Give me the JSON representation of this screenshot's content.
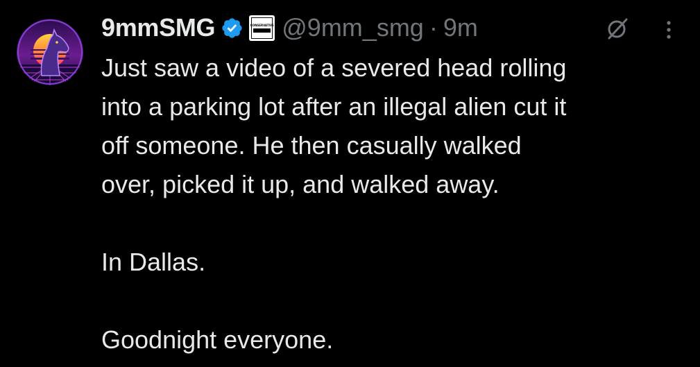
{
  "tweet": {
    "author": {
      "display_name": "9mmSMG",
      "verified": true,
      "affiliate_badge_text": "CONSERVATIVE",
      "handle": "@9mm_smg",
      "separator": "·",
      "time": "9m"
    },
    "body": {
      "line1": "Just saw a video of a severed head rolling",
      "line2": "into a parking lot after an illegal alien cut it",
      "line3": "off someone. He then casually walked",
      "line4": "over, picked it up, and walked away.",
      "para2": "In Dallas.",
      "para3": "Goodnight everyone."
    },
    "icons": {
      "avatar": "avatar-synthwave-horse",
      "verified": "verified-badge-icon",
      "grok": "grok-icon",
      "more": "more-options-icon"
    }
  },
  "colors": {
    "background": "#000000",
    "text_primary": "#e7e9ea",
    "text_secondary": "#71767b",
    "verified_blue": "#1d9bf0"
  }
}
